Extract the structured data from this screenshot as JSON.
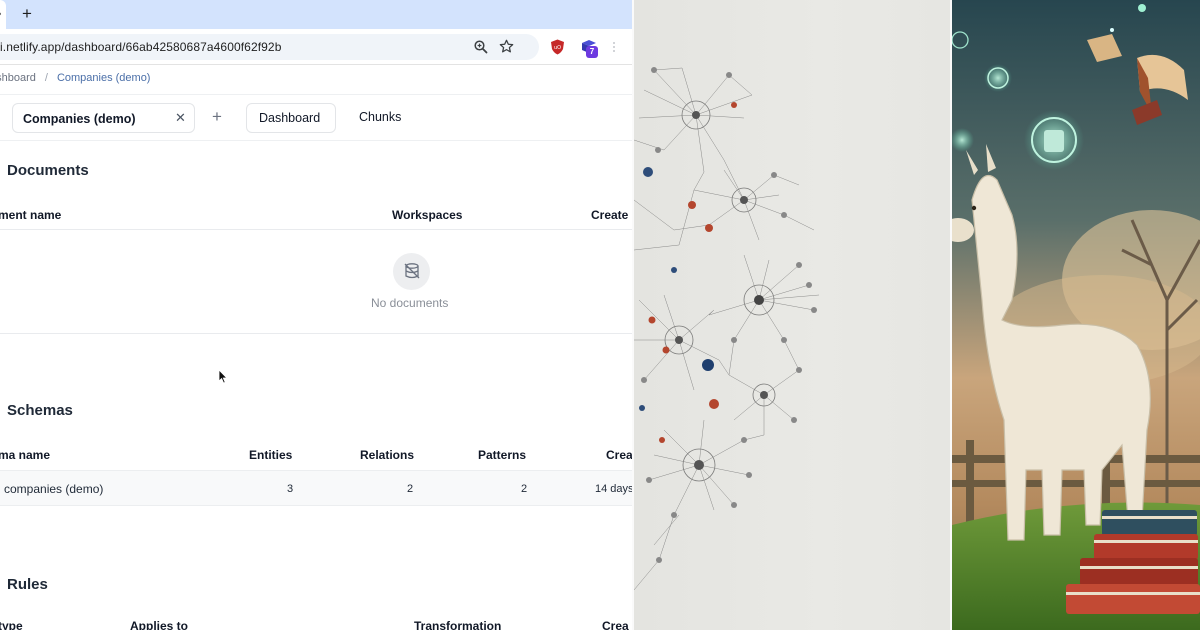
{
  "browser": {
    "new_tab_symbol": "+",
    "tab_fragment": "•",
    "url": "i.netlify.app/dashboard/66ab42580687a4600f62f92b",
    "extension_badge": "7"
  },
  "breadcrumb": {
    "root": "ashboard",
    "separator": "/",
    "current": "Companies (demo)"
  },
  "app_tabs": {
    "active_label": "Companies (demo)",
    "close_symbol": "✕",
    "add_symbol": "+",
    "tabs": [
      "Dashboard",
      "Chunks"
    ]
  },
  "documents": {
    "title": "Documents",
    "columns": [
      "ment name",
      "Workspaces",
      "Create"
    ],
    "empty_text": "No documents"
  },
  "schemas": {
    "title": "Schemas",
    "columns": [
      "ma name",
      "Entities",
      "Relations",
      "Patterns",
      "Crea"
    ],
    "rows": [
      {
        "name": "companies (demo)",
        "entities": "3",
        "relations": "2",
        "patterns": "2",
        "created": "14 days"
      }
    ]
  },
  "rules": {
    "title": "Rules",
    "columns": [
      "type",
      "Applies to",
      "Transformation",
      "Crea"
    ]
  },
  "colors": {
    "tabstrip": "#d3e3fd",
    "accent_link": "#4b6fa8",
    "ext_badge": "#6d3ae0"
  }
}
